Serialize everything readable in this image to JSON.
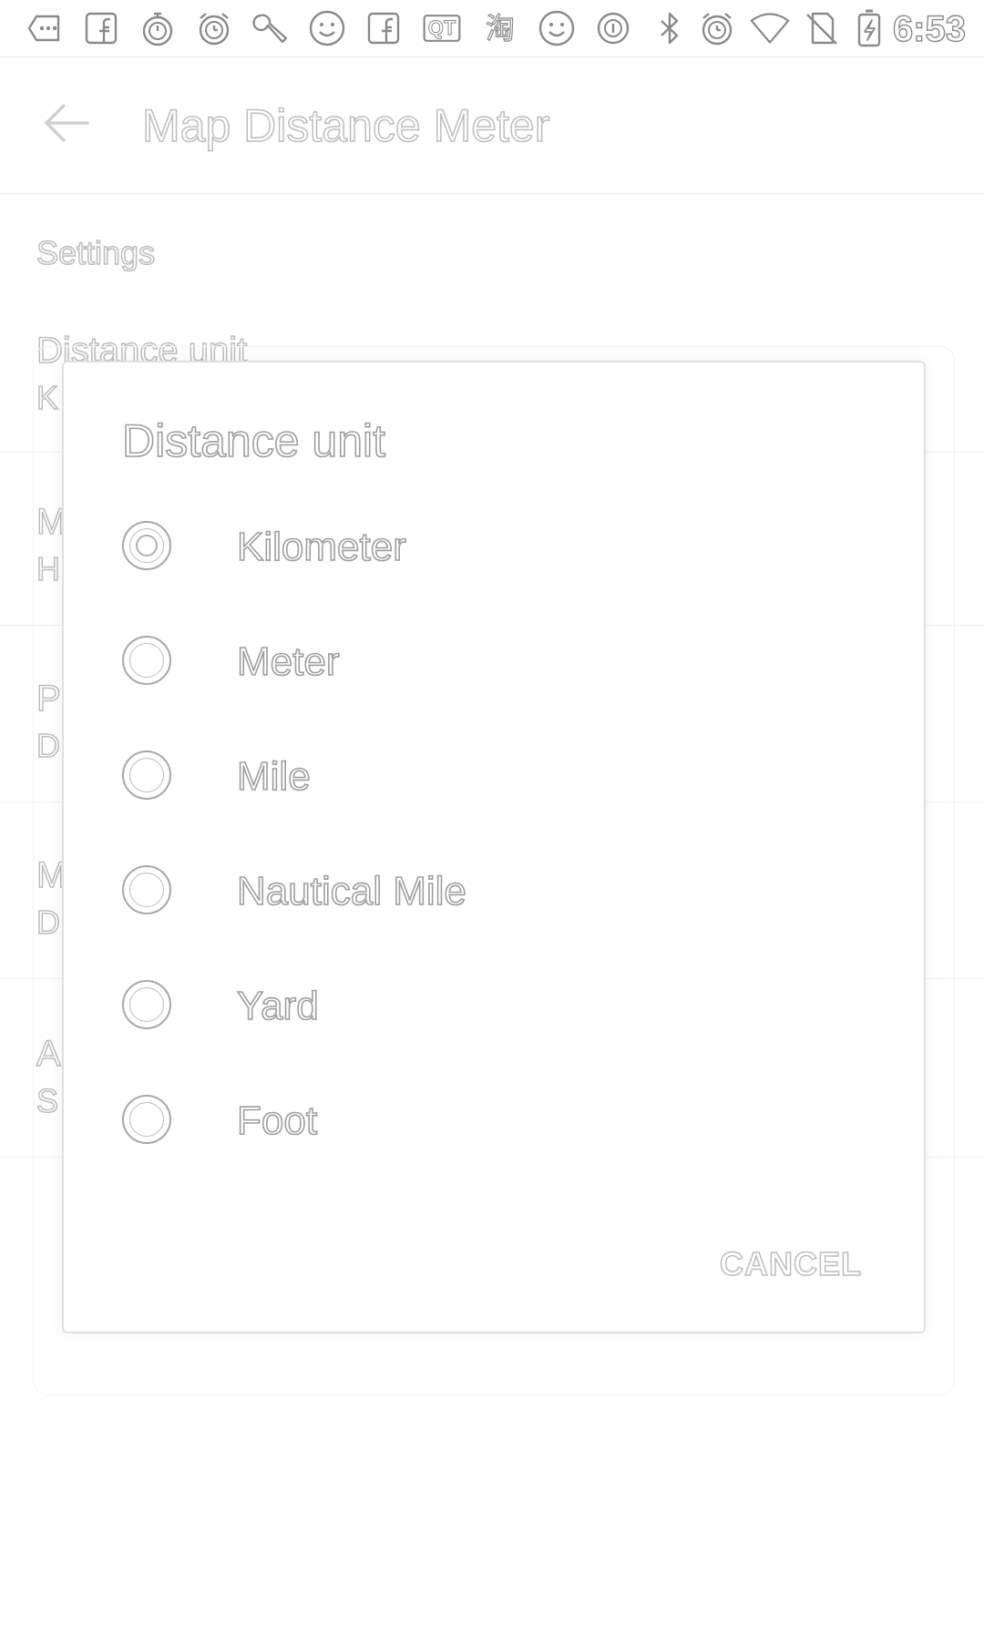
{
  "status_bar": {
    "time": "6:53",
    "icons": [
      "more-icon",
      "facebook-icon",
      "stopwatch-icon",
      "alarm-icon",
      "wrench-icon",
      "smiley-icon",
      "facebook-icon",
      "qt-icon",
      "taobao-icon",
      "smiley-icon",
      "round-info-icon",
      "bluetooth-icon",
      "alarm-icon",
      "wifi-icon",
      "no-sim-icon",
      "battery-charging-icon"
    ],
    "qt_label": "QT",
    "taobao_label": "淘"
  },
  "app_bar": {
    "title": "Map Distance Meter",
    "back_icon": "arrow-back-icon"
  },
  "settings": {
    "header": "Settings",
    "items": [
      {
        "title": "Distance unit",
        "summary": "K"
      },
      {
        "title": "M",
        "summary": "H"
      },
      {
        "title": "P",
        "summary": "D"
      },
      {
        "title": "M",
        "summary": "D"
      },
      {
        "title": "A",
        "summary": "S"
      }
    ]
  },
  "dialog": {
    "title": "Distance unit",
    "options": [
      {
        "label": "Kilometer",
        "checked": true
      },
      {
        "label": "Meter",
        "checked": false
      },
      {
        "label": "Mile",
        "checked": false
      },
      {
        "label": "Nautical Mile",
        "checked": false
      },
      {
        "label": "Yard",
        "checked": false
      },
      {
        "label": "Foot",
        "checked": false
      }
    ],
    "cancel_label": "CANCEL"
  }
}
